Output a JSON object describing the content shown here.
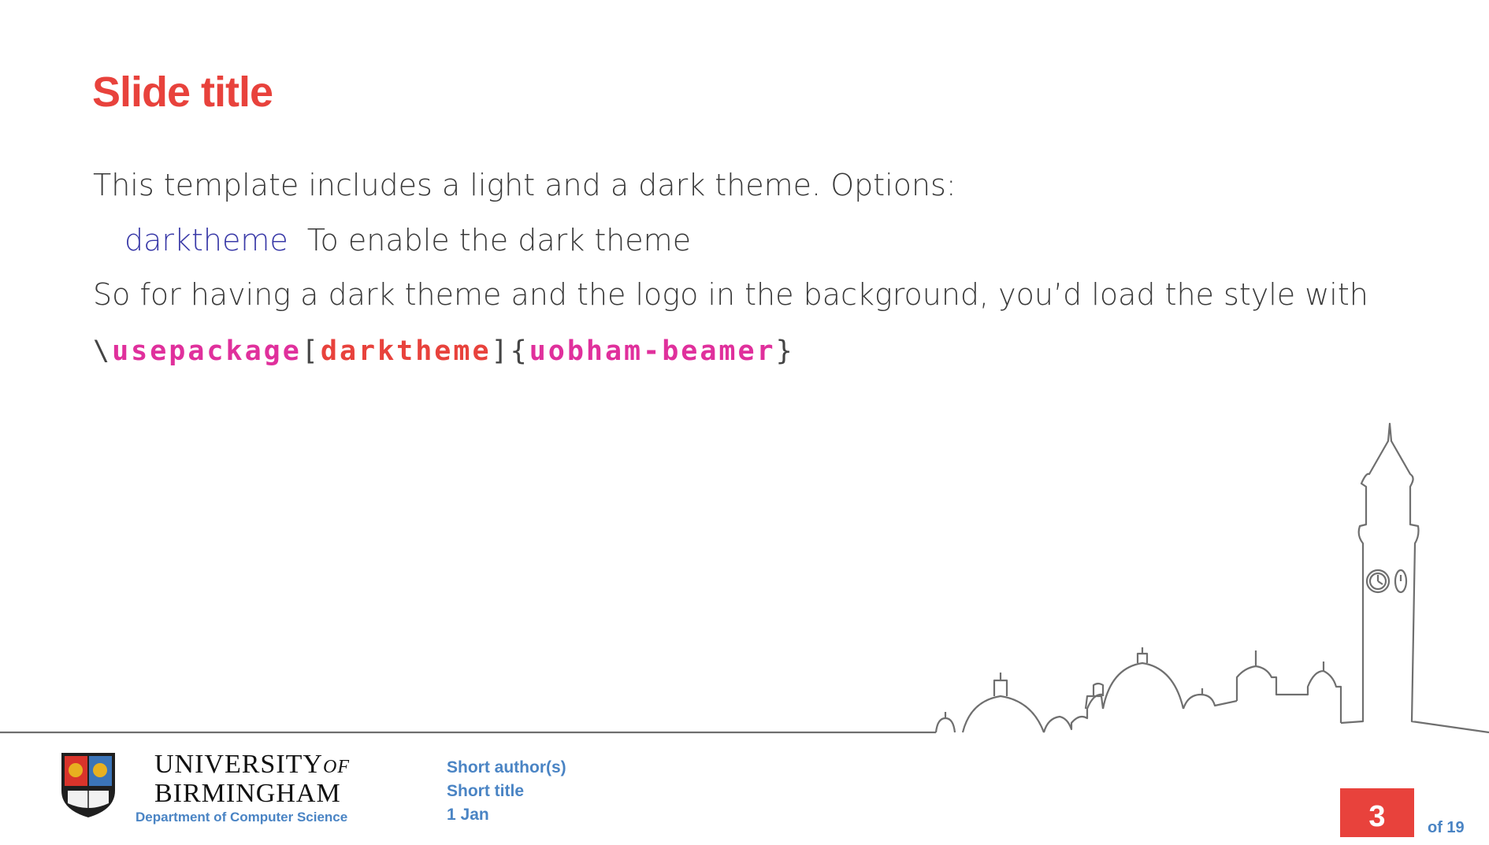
{
  "slide": {
    "title": "Slide title",
    "intro": "This template includes a light and a dark theme. Options:",
    "option": {
      "key": "darktheme",
      "description": "To enable the dark theme"
    },
    "note": "So for having a dark theme and the logo in the background, you’d load the style with",
    "code": {
      "backslash": "\\",
      "command": "usepackage",
      "open_bracket": "[",
      "option": "darktheme",
      "close_bracket": "]",
      "open_brace": "{",
      "package": "uobham-beamer",
      "close_brace": "}"
    }
  },
  "footer": {
    "university_line1": "UNIVERSITY",
    "university_of": "OF",
    "university_line2": "BIRMINGHAM",
    "department": "Department of Computer Science",
    "author": "Short author(s)",
    "short_title": "Short title",
    "date": "1 Jan",
    "page_number": "3",
    "page_total": "of 19"
  },
  "colors": {
    "title": "#e8423c",
    "option_key": "#3a3aa8",
    "code_command": "#e0309c",
    "footer_text": "#4a84c4",
    "page_box": "#e8423c"
  }
}
